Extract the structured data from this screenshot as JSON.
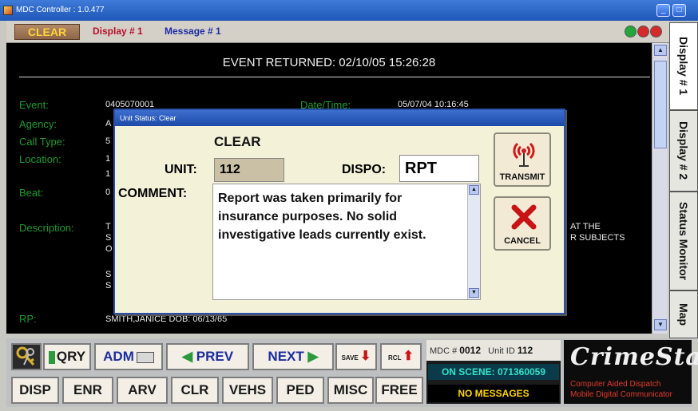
{
  "window": {
    "title": "MDC Controller : 1.0.477"
  },
  "menubar": {
    "status_button": "CLEAR",
    "tab1": "Display # 1",
    "tab2": "Message # 1"
  },
  "status_lights": [
    "#22a83a",
    "#d42a2a",
    "#d42a2a"
  ],
  "event": {
    "header": "EVENT RETURNED: 02/10/05 15:26:28",
    "event_label": "Event:",
    "event_value": "0405070001",
    "datetime_label": "Date/Time:",
    "datetime_value": "05/07/04 10:16:45",
    "agency_label": "Agency:",
    "agency_value": "A",
    "calltype_label": "Call Type:",
    "calltype_value": "5",
    "location_label": "Location:",
    "location_value_1": "1",
    "location_value_2": "1",
    "beat_label": "Beat:",
    "beat_value": "0",
    "description_label": "Description:",
    "description_left_1": "T",
    "description_left_2": "S",
    "description_left_3": "O",
    "description_left_4": "S",
    "description_left_5": "S",
    "description_right_1": "AT THE",
    "description_right_2": "R SUBJECTS",
    "rp_label": "RP:",
    "rp_value": "SMITH,JANICE DOB: 06/13/65"
  },
  "dialog": {
    "title": "Unit Status: Clear",
    "status": "CLEAR",
    "unit_label": "UNIT:",
    "unit_value": "112",
    "dispo_label": "DISPO:",
    "dispo_value": "RPT",
    "comment_label": "COMMENT:",
    "comment": "Report was taken primarily for insurance purposes.  No solid investigative leads currently exist.",
    "transmit_label": "TRANSMIT",
    "cancel_label": "CANCEL"
  },
  "side_tabs": [
    "Display # 1",
    "Display # 2",
    "Status Monitor",
    "Map"
  ],
  "toolbar": {
    "keys_icon": "keys-icon",
    "qry": "QRY",
    "adm": "ADM",
    "prev": "PREV",
    "next": "NEXT",
    "save": "SAVE",
    "rcl": "RCL",
    "disp": "DISP",
    "enr": "ENR",
    "arv": "ARV",
    "clr": "CLR",
    "vehs": "VEHS",
    "ped": "PED",
    "misc": "MISC",
    "free": "FREE"
  },
  "info": {
    "mdc_label": "MDC #",
    "mdc_value": "0012",
    "unit_label": "Unit ID",
    "unit_value": "112",
    "on_scene": "ON SCENE: 071360059",
    "messages": "NO MESSAGES"
  },
  "brand": {
    "name": "CrimeStar",
    "line1": "Computer Aided Dispatch",
    "line2": "Mobile Digital Communicator"
  }
}
